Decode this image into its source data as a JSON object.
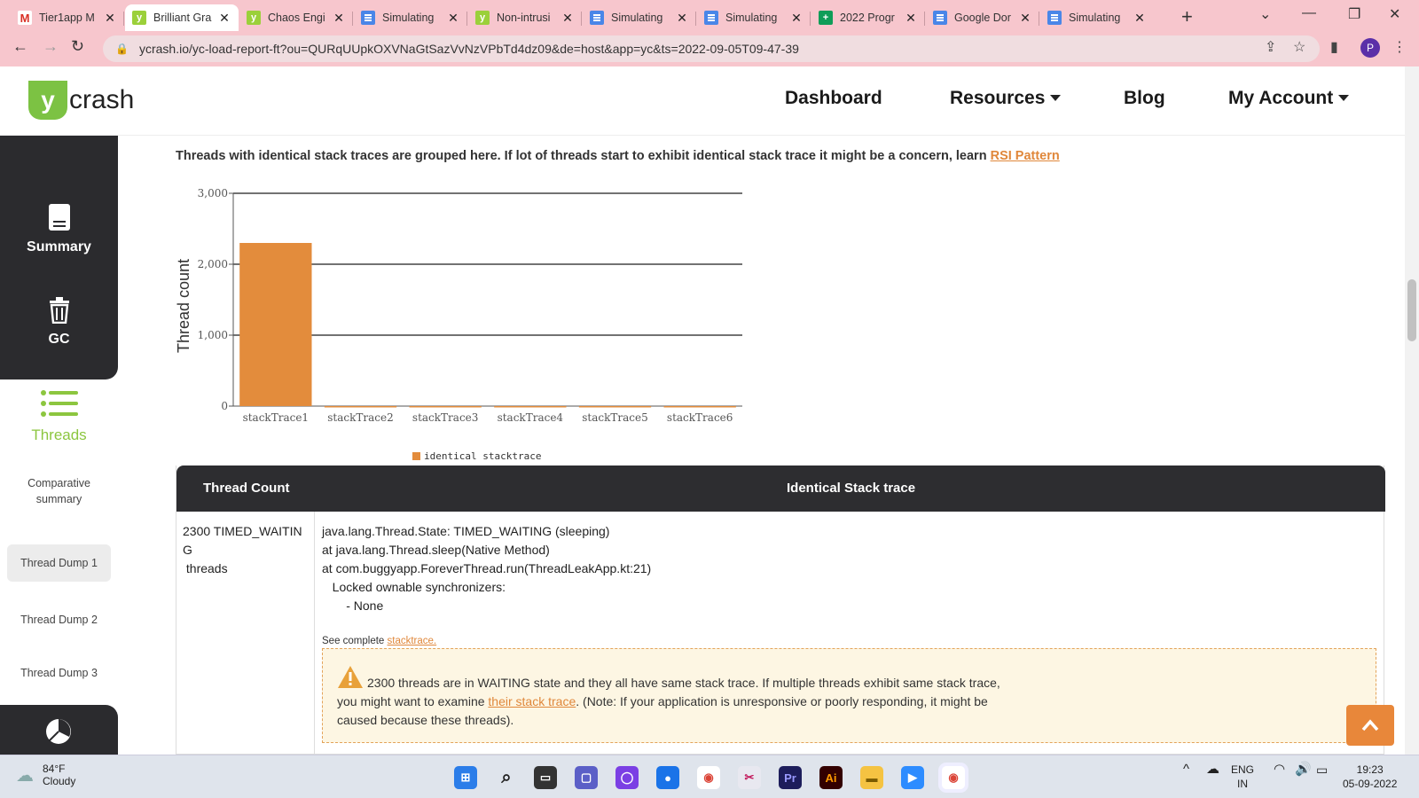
{
  "browser": {
    "tabs": [
      {
        "title": "Tier1app M",
        "icon": "gmail-icon"
      },
      {
        "title": "Brilliant Gra",
        "icon": "ycrash-icon"
      },
      {
        "title": "Chaos Engi",
        "icon": "ycrash-icon"
      },
      {
        "title": "Simulating",
        "icon": "docs-icon"
      },
      {
        "title": "Non-intrusi",
        "icon": "ycrash-icon"
      },
      {
        "title": "Simulating",
        "icon": "docs-icon"
      },
      {
        "title": "Simulating",
        "icon": "docs-icon"
      },
      {
        "title": "2022 Progr",
        "icon": "sheets-icon"
      },
      {
        "title": "Google Dor",
        "icon": "docs-icon"
      },
      {
        "title": "Simulating",
        "icon": "docs-icon"
      }
    ],
    "url": "ycrash.io/yc-load-report-ft?ou=QURqUUpkOXVNaGtSazVvNzVPbTd4dz09&de=host&app=yc&ts=2022-09-05T09-47-39",
    "profile_initial": "P"
  },
  "site": {
    "logo_mark": "y",
    "logo_text": "crash",
    "nav": {
      "dashboard": "Dashboard",
      "resources": "Resources",
      "blog": "Blog",
      "account": "My Account"
    }
  },
  "sidebar": {
    "summary": "Summary",
    "gc": "GC",
    "threads": "Threads",
    "comparative": "Comparative summary",
    "dump1": "Thread Dump 1",
    "dump2": "Thread Dump 2",
    "dump3": "Thread Dump 3"
  },
  "main": {
    "intro_text": "Threads with identical stack traces are grouped here. If lot of threads start to exhibit identical stack trace it might be a concern, learn ",
    "intro_link": "RSI Pattern",
    "table": {
      "col1": "Thread Count",
      "col2": "Identical Stack trace",
      "count_line1": "2300 TIMED_WAITING",
      "count_line2": " threads",
      "stack_lines": [
        "java.lang.Thread.State: TIMED_WAITING (sleeping)",
        "at java.lang.Thread.sleep(Native Method)",
        "at com.buggyapp.ForeverThread.run(ThreadLeakApp.kt:21)",
        "   Locked ownable synchronizers:",
        "       - None"
      ],
      "see_complete_prefix": "See complete ",
      "see_complete_link": "stacktrace.",
      "warning_part1": "2300 threads are in WAITING state and they all have same stack trace. If multiple threads exhibit same stack trace, you might want to examine ",
      "warning_link": "their stack trace",
      "warning_part2": ". (Note: If your application is unresponsive or poorly responding, it might be caused because these threads)."
    }
  },
  "chart_data": {
    "type": "bar",
    "categories": [
      "stackTrace1",
      "stackTrace2",
      "stackTrace3",
      "stackTrace4",
      "stackTrace5",
      "stackTrace6"
    ],
    "series": [
      {
        "name": "identical stacktrace",
        "values": [
          2300,
          0,
          0,
          0,
          0,
          0
        ],
        "color": "#e38c3c"
      }
    ],
    "ylabel": "Thread count",
    "xlabel": "",
    "ylim": [
      0,
      3000
    ],
    "yticks": [
      "0",
      "1,000",
      "2,000",
      "3,000"
    ],
    "grid": true,
    "legend": "bottom-center"
  },
  "taskbar": {
    "temperature": "84°F",
    "condition": "Cloudy",
    "lang1": "ENG",
    "lang2": "IN",
    "time": "19:23",
    "date": "05-09-2022"
  },
  "colors": {
    "accent": "#e0873a",
    "brand_green": "#7cc243",
    "dark": "#2b2b2e"
  }
}
